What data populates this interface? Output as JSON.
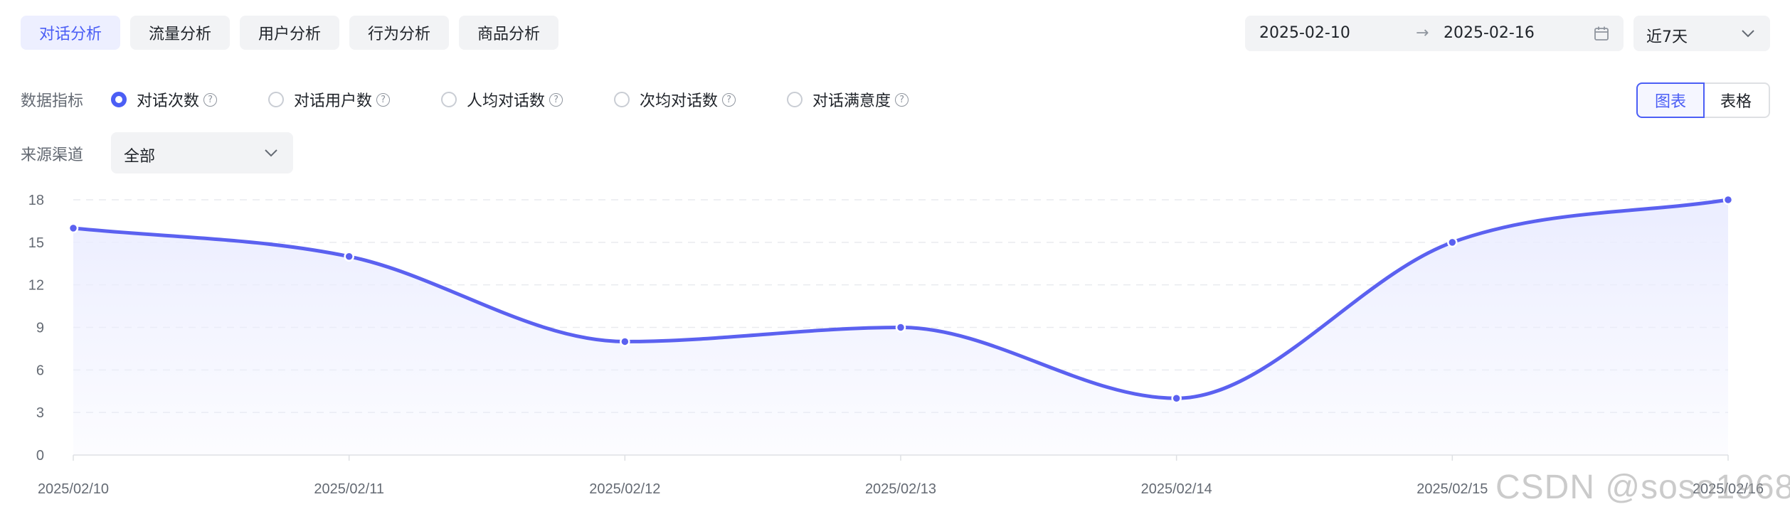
{
  "tabs": [
    {
      "label": "对话分析",
      "active": true
    },
    {
      "label": "流量分析",
      "active": false
    },
    {
      "label": "用户分析",
      "active": false
    },
    {
      "label": "行为分析",
      "active": false
    },
    {
      "label": "商品分析",
      "active": false
    }
  ],
  "date_range": {
    "start": "2025-02-10",
    "separator": "→",
    "end": "2025-02-16",
    "icon": "calendar-icon"
  },
  "period_select": {
    "value": "近7天",
    "icon": "chevron-down-icon"
  },
  "metrics": {
    "label": "数据指标",
    "options": [
      {
        "label": "对话次数",
        "checked": true
      },
      {
        "label": "对话用户数",
        "checked": false
      },
      {
        "label": "人均对话数",
        "checked": false
      },
      {
        "label": "次均对话数",
        "checked": false
      },
      {
        "label": "对话满意度",
        "checked": false
      }
    ],
    "help_glyph": "?"
  },
  "view_toggle": {
    "chart_label": "图表",
    "table_label": "表格",
    "active": "chart"
  },
  "channel": {
    "label": "来源渠道",
    "value": "全部"
  },
  "colors": {
    "accent": "#4b5ef5",
    "line": "#5b61f0",
    "area_top": "#ebedff"
  },
  "watermark": "CSDN @soso1968",
  "chart_data": {
    "type": "area",
    "smooth": true,
    "x": [
      "2025/02/10",
      "2025/02/11",
      "2025/02/12",
      "2025/02/13",
      "2025/02/14",
      "2025/02/15",
      "2025/02/16"
    ],
    "series": [
      {
        "values": [
          16,
          14,
          8,
          9,
          4,
          15,
          18
        ]
      }
    ],
    "yticks": [
      0,
      3,
      6,
      9,
      12,
      15,
      18
    ],
    "ylim": [
      0,
      18
    ],
    "grid": true,
    "legend": "none"
  }
}
